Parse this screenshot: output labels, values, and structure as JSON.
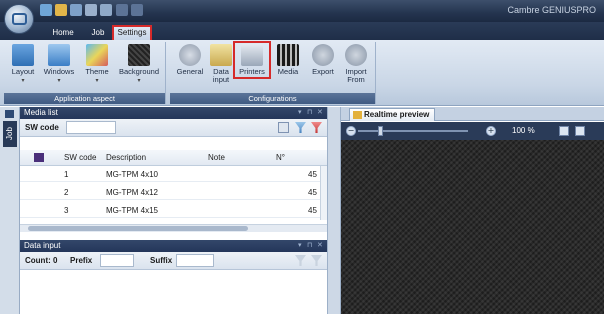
{
  "app": {
    "title": "Cambre GENIUSPRO"
  },
  "ribbon": {
    "tabs": [
      {
        "label": "Home"
      },
      {
        "label": "Job"
      },
      {
        "label": "Settings",
        "active": true
      }
    ],
    "groups": {
      "application_aspect": {
        "label": "Application aspect",
        "buttons": [
          {
            "label": "Layout",
            "icon": "layout-icon"
          },
          {
            "label": "Windows",
            "icon": "windows-icon"
          },
          {
            "label": "Theme",
            "icon": "theme-icon"
          },
          {
            "label": "Background",
            "icon": "background-icon"
          }
        ]
      },
      "configurations": {
        "label": "Configurations",
        "buttons": [
          {
            "label": "General",
            "icon": "gears-icon"
          },
          {
            "label": "Data input",
            "icon": "data-input-icon"
          },
          {
            "label": "Printers",
            "icon": "printer-icon",
            "highlighted": true
          },
          {
            "label": "Media",
            "icon": "media-icon"
          },
          {
            "label": "Export",
            "icon": "export-icon"
          },
          {
            "label": "Import From",
            "icon": "import-icon"
          }
        ]
      }
    }
  },
  "side": {
    "job_tab": "Job"
  },
  "media_list": {
    "title": "Media list",
    "sw_code_label": "SW code",
    "sw_code_value": "",
    "columns": [
      "SW code",
      "Description",
      "Note",
      "N°"
    ],
    "rows": [
      {
        "sw": "1",
        "desc": "MG-TPM 4x10",
        "note": "",
        "n": "45"
      },
      {
        "sw": "2",
        "desc": "MG-TPM 4x12",
        "note": "",
        "n": "45"
      },
      {
        "sw": "3",
        "desc": "MG-TPM 4x15",
        "note": "",
        "n": "45"
      }
    ]
  },
  "data_input": {
    "title": "Data input",
    "count_label": "Count: 0",
    "prefix_label": "Prefix",
    "suffix_label": "Suffix",
    "prefix_value": "",
    "suffix_value": ""
  },
  "preview": {
    "tab_label": "Realtime preview",
    "zoom": "100 %"
  },
  "colors": {
    "highlight": "#d62a2a",
    "chrome_dark": "#24344f",
    "ribbon": "#c9d6e6"
  }
}
